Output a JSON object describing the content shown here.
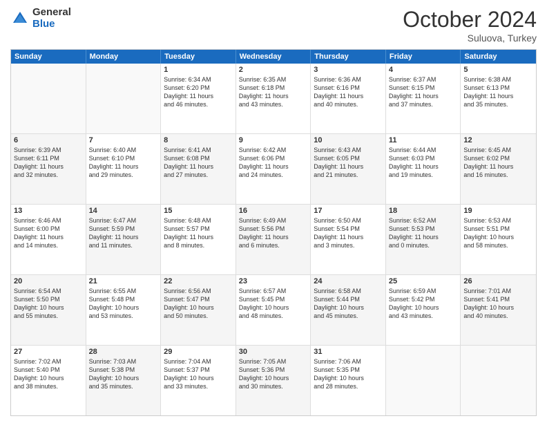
{
  "header": {
    "logo_general": "General",
    "logo_blue": "Blue",
    "month_title": "October 2024",
    "subtitle": "Suluova, Turkey"
  },
  "weekdays": [
    "Sunday",
    "Monday",
    "Tuesday",
    "Wednesday",
    "Thursday",
    "Friday",
    "Saturday"
  ],
  "rows": [
    [
      {
        "day": "",
        "lines": [],
        "empty": true
      },
      {
        "day": "",
        "lines": [],
        "empty": true
      },
      {
        "day": "1",
        "lines": [
          "Sunrise: 6:34 AM",
          "Sunset: 6:20 PM",
          "Daylight: 11 hours",
          "and 46 minutes."
        ]
      },
      {
        "day": "2",
        "lines": [
          "Sunrise: 6:35 AM",
          "Sunset: 6:18 PM",
          "Daylight: 11 hours",
          "and 43 minutes."
        ]
      },
      {
        "day": "3",
        "lines": [
          "Sunrise: 6:36 AM",
          "Sunset: 6:16 PM",
          "Daylight: 11 hours",
          "and 40 minutes."
        ]
      },
      {
        "day": "4",
        "lines": [
          "Sunrise: 6:37 AM",
          "Sunset: 6:15 PM",
          "Daylight: 11 hours",
          "and 37 minutes."
        ]
      },
      {
        "day": "5",
        "lines": [
          "Sunrise: 6:38 AM",
          "Sunset: 6:13 PM",
          "Daylight: 11 hours",
          "and 35 minutes."
        ]
      }
    ],
    [
      {
        "day": "6",
        "lines": [
          "Sunrise: 6:39 AM",
          "Sunset: 6:11 PM",
          "Daylight: 11 hours",
          "and 32 minutes."
        ],
        "shaded": true
      },
      {
        "day": "7",
        "lines": [
          "Sunrise: 6:40 AM",
          "Sunset: 6:10 PM",
          "Daylight: 11 hours",
          "and 29 minutes."
        ]
      },
      {
        "day": "8",
        "lines": [
          "Sunrise: 6:41 AM",
          "Sunset: 6:08 PM",
          "Daylight: 11 hours",
          "and 27 minutes."
        ],
        "shaded": true
      },
      {
        "day": "9",
        "lines": [
          "Sunrise: 6:42 AM",
          "Sunset: 6:06 PM",
          "Daylight: 11 hours",
          "and 24 minutes."
        ]
      },
      {
        "day": "10",
        "lines": [
          "Sunrise: 6:43 AM",
          "Sunset: 6:05 PM",
          "Daylight: 11 hours",
          "and 21 minutes."
        ],
        "shaded": true
      },
      {
        "day": "11",
        "lines": [
          "Sunrise: 6:44 AM",
          "Sunset: 6:03 PM",
          "Daylight: 11 hours",
          "and 19 minutes."
        ]
      },
      {
        "day": "12",
        "lines": [
          "Sunrise: 6:45 AM",
          "Sunset: 6:02 PM",
          "Daylight: 11 hours",
          "and 16 minutes."
        ],
        "shaded": true
      }
    ],
    [
      {
        "day": "13",
        "lines": [
          "Sunrise: 6:46 AM",
          "Sunset: 6:00 PM",
          "Daylight: 11 hours",
          "and 14 minutes."
        ]
      },
      {
        "day": "14",
        "lines": [
          "Sunrise: 6:47 AM",
          "Sunset: 5:59 PM",
          "Daylight: 11 hours",
          "and 11 minutes."
        ],
        "shaded": true
      },
      {
        "day": "15",
        "lines": [
          "Sunrise: 6:48 AM",
          "Sunset: 5:57 PM",
          "Daylight: 11 hours",
          "and 8 minutes."
        ]
      },
      {
        "day": "16",
        "lines": [
          "Sunrise: 6:49 AM",
          "Sunset: 5:56 PM",
          "Daylight: 11 hours",
          "and 6 minutes."
        ],
        "shaded": true
      },
      {
        "day": "17",
        "lines": [
          "Sunrise: 6:50 AM",
          "Sunset: 5:54 PM",
          "Daylight: 11 hours",
          "and 3 minutes."
        ]
      },
      {
        "day": "18",
        "lines": [
          "Sunrise: 6:52 AM",
          "Sunset: 5:53 PM",
          "Daylight: 11 hours",
          "and 0 minutes."
        ],
        "shaded": true
      },
      {
        "day": "19",
        "lines": [
          "Sunrise: 6:53 AM",
          "Sunset: 5:51 PM",
          "Daylight: 10 hours",
          "and 58 minutes."
        ]
      }
    ],
    [
      {
        "day": "20",
        "lines": [
          "Sunrise: 6:54 AM",
          "Sunset: 5:50 PM",
          "Daylight: 10 hours",
          "and 55 minutes."
        ],
        "shaded": true
      },
      {
        "day": "21",
        "lines": [
          "Sunrise: 6:55 AM",
          "Sunset: 5:48 PM",
          "Daylight: 10 hours",
          "and 53 minutes."
        ]
      },
      {
        "day": "22",
        "lines": [
          "Sunrise: 6:56 AM",
          "Sunset: 5:47 PM",
          "Daylight: 10 hours",
          "and 50 minutes."
        ],
        "shaded": true
      },
      {
        "day": "23",
        "lines": [
          "Sunrise: 6:57 AM",
          "Sunset: 5:45 PM",
          "Daylight: 10 hours",
          "and 48 minutes."
        ]
      },
      {
        "day": "24",
        "lines": [
          "Sunrise: 6:58 AM",
          "Sunset: 5:44 PM",
          "Daylight: 10 hours",
          "and 45 minutes."
        ],
        "shaded": true
      },
      {
        "day": "25",
        "lines": [
          "Sunrise: 6:59 AM",
          "Sunset: 5:42 PM",
          "Daylight: 10 hours",
          "and 43 minutes."
        ]
      },
      {
        "day": "26",
        "lines": [
          "Sunrise: 7:01 AM",
          "Sunset: 5:41 PM",
          "Daylight: 10 hours",
          "and 40 minutes."
        ],
        "shaded": true
      }
    ],
    [
      {
        "day": "27",
        "lines": [
          "Sunrise: 7:02 AM",
          "Sunset: 5:40 PM",
          "Daylight: 10 hours",
          "and 38 minutes."
        ]
      },
      {
        "day": "28",
        "lines": [
          "Sunrise: 7:03 AM",
          "Sunset: 5:38 PM",
          "Daylight: 10 hours",
          "and 35 minutes."
        ],
        "shaded": true
      },
      {
        "day": "29",
        "lines": [
          "Sunrise: 7:04 AM",
          "Sunset: 5:37 PM",
          "Daylight: 10 hours",
          "and 33 minutes."
        ]
      },
      {
        "day": "30",
        "lines": [
          "Sunrise: 7:05 AM",
          "Sunset: 5:36 PM",
          "Daylight: 10 hours",
          "and 30 minutes."
        ],
        "shaded": true
      },
      {
        "day": "31",
        "lines": [
          "Sunrise: 7:06 AM",
          "Sunset: 5:35 PM",
          "Daylight: 10 hours",
          "and 28 minutes."
        ]
      },
      {
        "day": "",
        "lines": [],
        "empty": true
      },
      {
        "day": "",
        "lines": [],
        "empty": true
      }
    ]
  ]
}
